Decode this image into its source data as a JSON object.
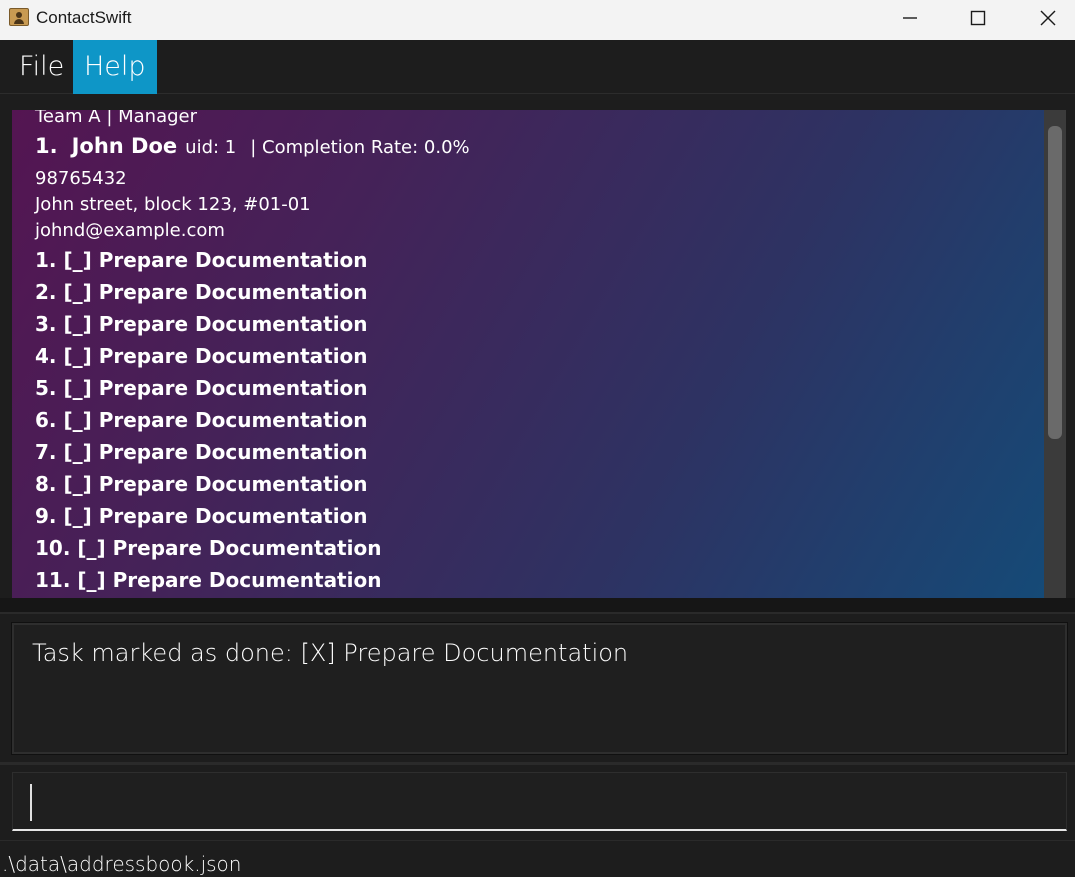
{
  "window": {
    "title": "ContactSwift",
    "app_icon": "contacts-icon",
    "controls": [
      "minimize-icon",
      "maximize-icon",
      "close-icon"
    ]
  },
  "menu": {
    "file": "File",
    "help": "Help"
  },
  "person": {
    "tags": "Team A | Manager",
    "index": "1.",
    "name": "John Doe",
    "uid": "uid: 1",
    "completion": "| Completion Rate: 0.0%",
    "phone": "98765432",
    "address": "John street, block 123, #01-01",
    "email": "johnd@example.com",
    "tasks": [
      "1. [_] Prepare Documentation",
      "2. [_] Prepare Documentation",
      "3. [_] Prepare Documentation",
      "4. [_] Prepare Documentation",
      "5. [_] Prepare Documentation",
      "6. [_] Prepare Documentation",
      "7. [_] Prepare Documentation",
      "8. [_] Prepare Documentation",
      "9. [_] Prepare Documentation",
      "10. [_] Prepare Documentation",
      "11. [_] Prepare Documentation"
    ]
  },
  "result": {
    "message": "Task marked as done: [X] Prepare Documentation"
  },
  "command": {
    "value": "",
    "placeholder": ""
  },
  "status": {
    "file_path": ".\\data\\addressbook.json"
  },
  "colors": {
    "menu_active": "#0e96c7",
    "card_gradient_start": "#541552",
    "card_gradient_end": "#154a77",
    "background": "#1d1d1d"
  }
}
